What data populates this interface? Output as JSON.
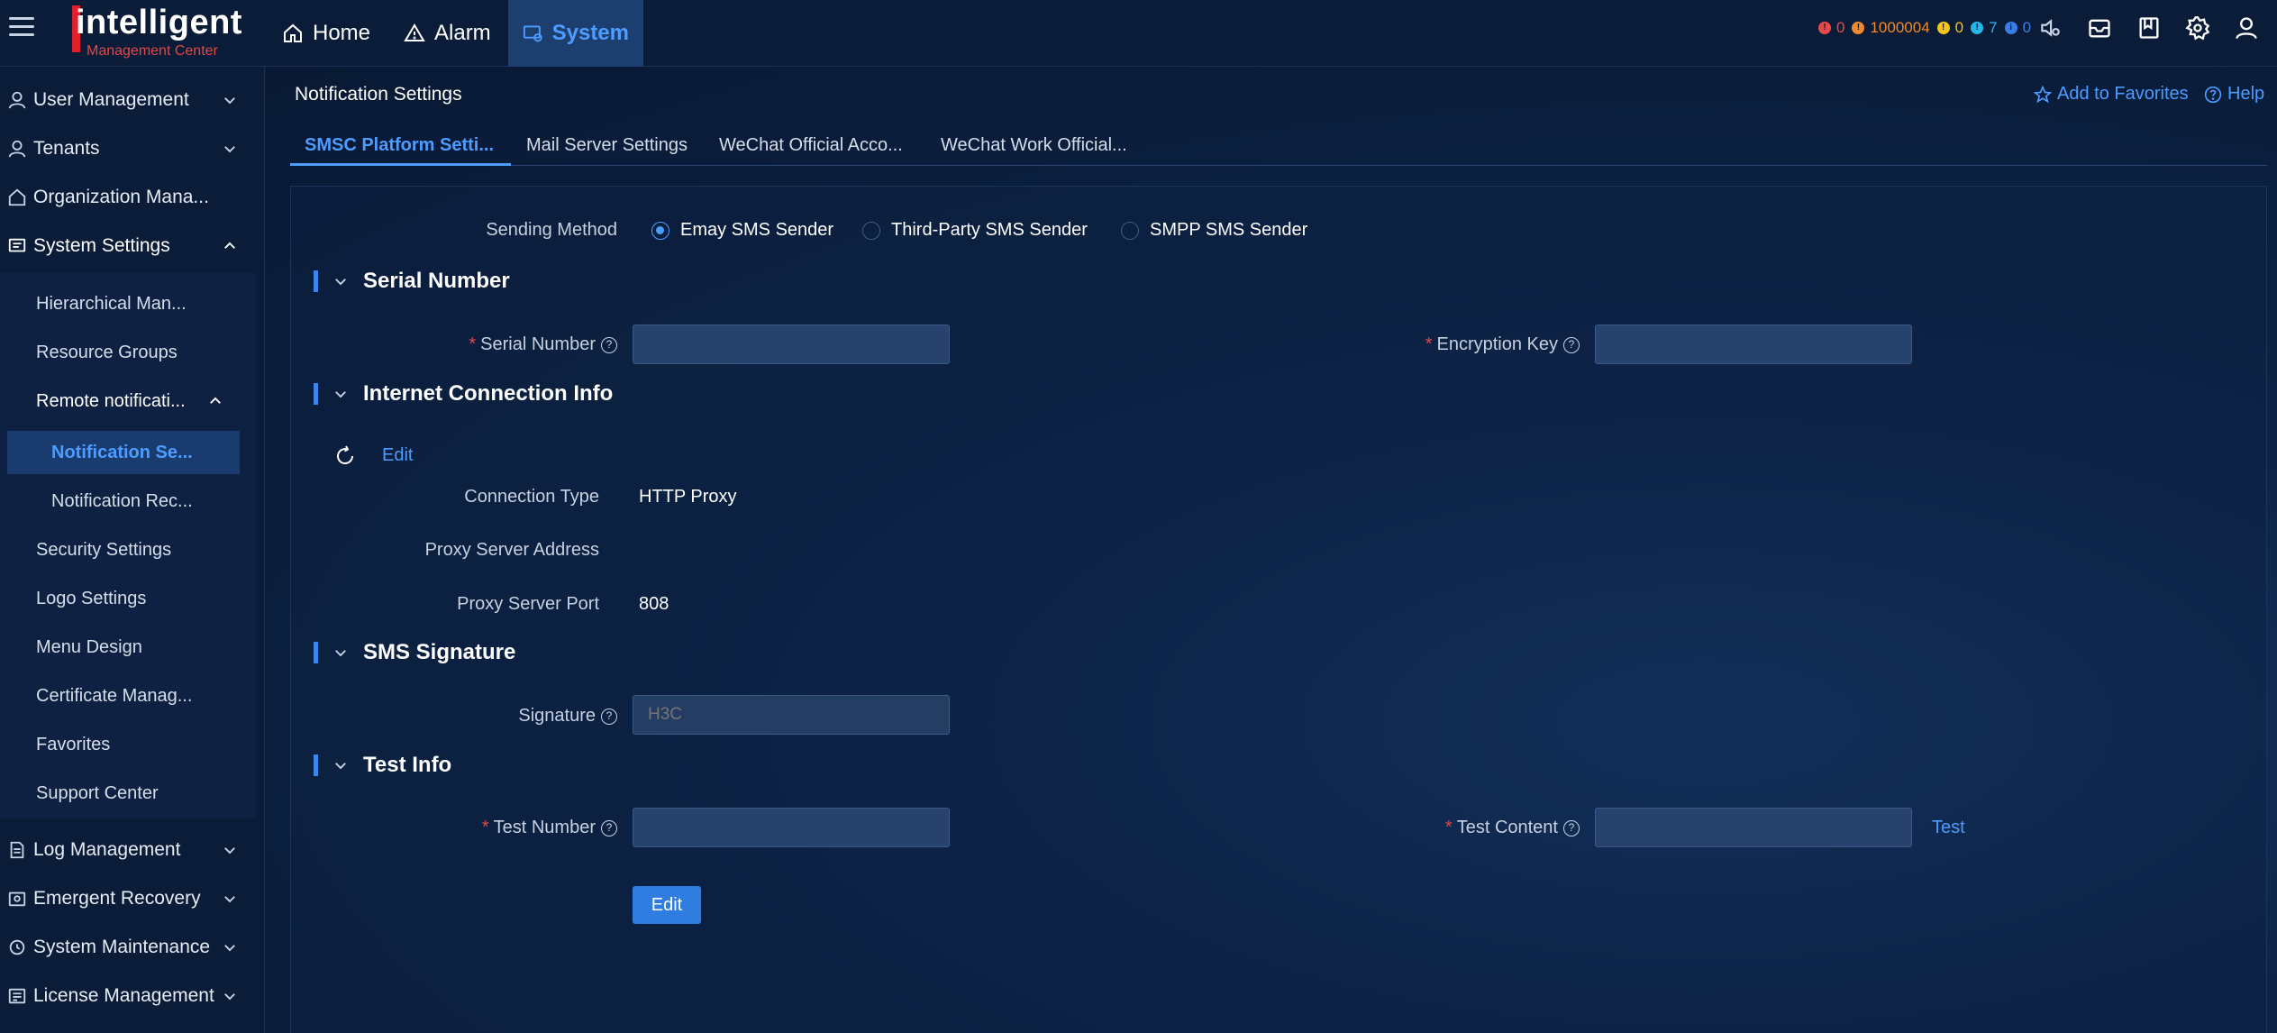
{
  "logo": {
    "main": "intelligent",
    "sub": "Management Center"
  },
  "nav": {
    "home": "Home",
    "alarm": "Alarm",
    "system": "System"
  },
  "status": [
    {
      "value": "0",
      "color": "#e84a4a",
      "text_color": "#e84a4a"
    },
    {
      "value": "1000004",
      "color": "#f08a2c",
      "text_color": "#f08a2c"
    },
    {
      "value": "0",
      "color": "#f5c518",
      "text_color": "#f5c518"
    },
    {
      "value": "7",
      "color": "#27b6e8",
      "text_color": "#27b6e8"
    },
    {
      "value": "0",
      "color": "#3b7de8",
      "text_color": "#3b7de8"
    }
  ],
  "sidebar": {
    "items": [
      {
        "label": "User Management",
        "icon": "user-icon"
      },
      {
        "label": "Tenants",
        "icon": "tenant-icon"
      },
      {
        "label": "Organization Mana...",
        "icon": "organization-icon"
      },
      {
        "label": "System Settings",
        "icon": "settings-icon"
      },
      {
        "label": "Log Management",
        "icon": "log-icon"
      },
      {
        "label": "Emergent Recovery",
        "icon": "recovery-icon"
      },
      {
        "label": "System Maintenance",
        "icon": "maintenance-icon"
      },
      {
        "label": "License Management",
        "icon": "license-icon"
      }
    ],
    "system_settings_children": [
      "Hierarchical Man...",
      "Resource Groups",
      "Remote notificati...",
      "Security Settings",
      "Logo Settings",
      "Menu Design",
      "Certificate Manag...",
      "Favorites",
      "Support Center"
    ],
    "remote_children": [
      "Notification Se...",
      "Notification Rec..."
    ]
  },
  "page": {
    "title": "Notification Settings",
    "add_favorites": "Add to Favorites",
    "help": "Help"
  },
  "tabs": [
    "SMSC Platform Setti...",
    "Mail Server Settings",
    "WeChat Official Acco...",
    "WeChat Work Official..."
  ],
  "form": {
    "sending_method_label": "Sending Method",
    "methods": [
      "Emay SMS Sender",
      "Third-Party SMS Sender",
      "SMPP SMS Sender"
    ],
    "selected_method": "Emay SMS Sender",
    "sections": {
      "serial": "Serial Number",
      "internet": "Internet Connection Info",
      "signature": "SMS Signature",
      "test": "Test Info"
    },
    "serial_number_label": "Serial Number",
    "serial_number_value": "",
    "encryption_key_label": "Encryption Key",
    "encryption_key_value": "",
    "edit_link": "Edit",
    "connection_type_label": "Connection Type",
    "connection_type_value": "HTTP Proxy",
    "proxy_address_label": "Proxy Server Address",
    "proxy_address_value": "",
    "proxy_port_label": "Proxy Server Port",
    "proxy_port_value": "808",
    "signature_label": "Signature",
    "signature_placeholder": "H3C",
    "test_number_label": "Test Number",
    "test_number_value": "",
    "test_content_label": "Test Content",
    "test_content_value": "",
    "test_link": "Test",
    "edit_button": "Edit"
  },
  "colors": {
    "accent": "#4d9cff",
    "required": "#e14848",
    "button": "#2f7de1"
  }
}
